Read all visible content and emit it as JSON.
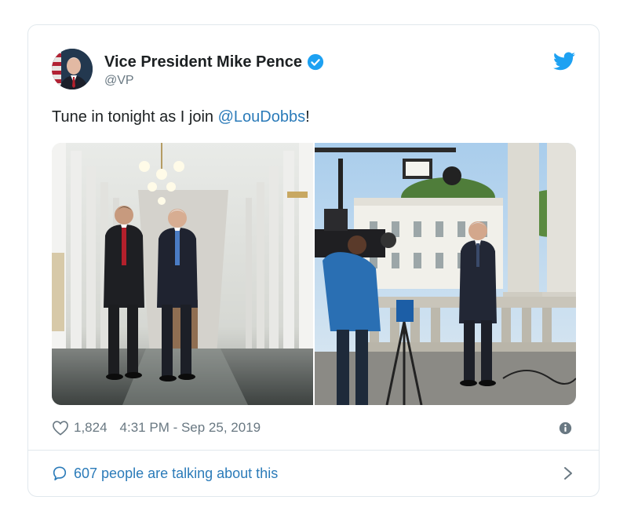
{
  "tweet": {
    "display_name": "Vice President Mike Pence",
    "handle": "@VP",
    "text_before": "Tune in tonight as I join ",
    "mention": "@LouDobbs",
    "text_after": "!",
    "likes": "1,824",
    "timestamp": "4:31 PM - Sep 25, 2019",
    "talking": "607 people are talking about this"
  },
  "colors": {
    "link_blue": "#2b7bb9",
    "twitter_blue": "#1da1f2",
    "muted_gray": "#697882",
    "border": "#e1e8ed"
  },
  "icons": {
    "verified": "verified-badge-icon",
    "logo": "twitter-bird-icon",
    "like": "heart-icon",
    "info": "info-icon",
    "reply": "speech-bubble-icon",
    "more": "chevron-right-icon"
  }
}
